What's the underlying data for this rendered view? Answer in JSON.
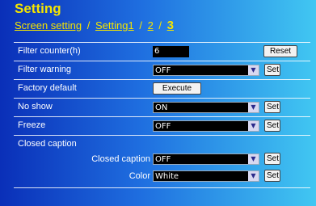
{
  "title": "Setting",
  "breadcrumbs": {
    "screen_setting": "Screen setting",
    "setting1": "Setting1",
    "page2": "2",
    "page3": "3",
    "sep": "/"
  },
  "rows": {
    "filter_counter": {
      "label": "Filter counter(h)",
      "value": "6",
      "button": "Reset"
    },
    "filter_warning": {
      "label": "Filter warning",
      "value": "OFF",
      "button": "Set"
    },
    "factory_default": {
      "label": "Factory default",
      "button": "Execute"
    },
    "no_show": {
      "label": "No show",
      "value": "ON",
      "button": "Set"
    },
    "freeze": {
      "label": "Freeze",
      "value": "OFF",
      "button": "Set"
    },
    "closed_caption": {
      "label": "Closed caption",
      "cc_label": "Closed caption",
      "cc_value": "OFF",
      "cc_button": "Set",
      "color_label": "Color",
      "color_value": "White",
      "color_button": "Set"
    }
  }
}
